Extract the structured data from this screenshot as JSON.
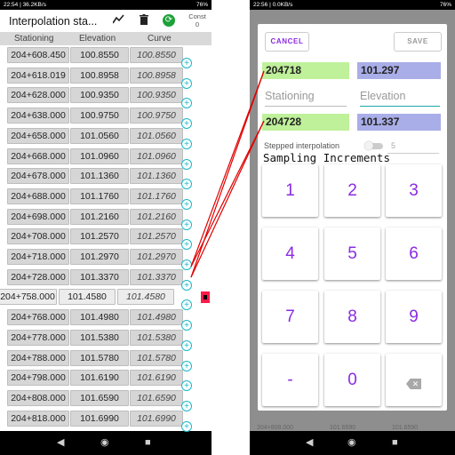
{
  "left": {
    "status": {
      "time_info": "22:54 | 36.2KB/s",
      "right": "76%"
    },
    "app_title": "Interpolation sta...",
    "const_label": "Const",
    "const_value": "0",
    "columns": [
      "Stationing",
      "Elevation",
      "Curve"
    ],
    "rows": [
      {
        "s": "204+608.450",
        "e": "100.8550",
        "c": "100.8550"
      },
      {
        "s": "204+618.019",
        "e": "100.8958",
        "c": "100.8958"
      },
      {
        "s": "204+628.000",
        "e": "100.9350",
        "c": "100.9350"
      },
      {
        "s": "204+638.000",
        "e": "100.9750",
        "c": "100.9750"
      },
      {
        "s": "204+658.000",
        "e": "101.0560",
        "c": "101.0560"
      },
      {
        "s": "204+668.000",
        "e": "101.0960",
        "c": "101.0960"
      },
      {
        "s": "204+678.000",
        "e": "101.1360",
        "c": "101.1360"
      },
      {
        "s": "204+688.000",
        "e": "101.1760",
        "c": "101.1760"
      },
      {
        "s": "204+698.000",
        "e": "101.2160",
        "c": "101.2160"
      },
      {
        "s": "204+708.000",
        "e": "101.2570",
        "c": "101.2570"
      },
      {
        "s": "204+718.000",
        "e": "101.2970",
        "c": "101.2970"
      },
      {
        "s": "204+728.000",
        "e": "101.3370",
        "c": "101.3370"
      },
      {
        "s": "204+758.000",
        "e": "101.4580",
        "c": "101.4580"
      },
      {
        "s": "204+768.000",
        "e": "101.4980",
        "c": "101.4980"
      },
      {
        "s": "204+778.000",
        "e": "101.5380",
        "c": "101.5380"
      },
      {
        "s": "204+788.000",
        "e": "101.5780",
        "c": "101.5780"
      },
      {
        "s": "204+798.000",
        "e": "101.6190",
        "c": "101.6190"
      },
      {
        "s": "204+808.000",
        "e": "101.6590",
        "c": "101.6590"
      },
      {
        "s": "204+818.000",
        "e": "101.6990",
        "c": "101.6990"
      }
    ]
  },
  "right": {
    "status": {
      "time_info": "22:56 | 0.0KB/s",
      "right": "76%"
    },
    "cancel_label": "CANCEL",
    "save_label": "SAVE",
    "start_station": "204718",
    "start_elevation": "101.297",
    "stationing_label": "Stationing",
    "elevation_label": "Elevation",
    "end_station": "204728",
    "end_elevation": "101.337",
    "stepped_label": "Stepped interpolation",
    "step_value": "5",
    "sampling_label": "Sampling Increments",
    "keys": [
      "1",
      "2",
      "3",
      "4",
      "5",
      "6",
      "7",
      "8",
      "9",
      "-",
      "0"
    ],
    "bg_rows": [
      "204+808.000",
      "101.6590",
      "101.6590"
    ]
  },
  "colors": {
    "accent": "#8a2be2",
    "green_box": "#bff09a",
    "blue_box": "#a9aee8",
    "plus_teal": "#19b7c7",
    "annotation_red": "#e00000"
  }
}
